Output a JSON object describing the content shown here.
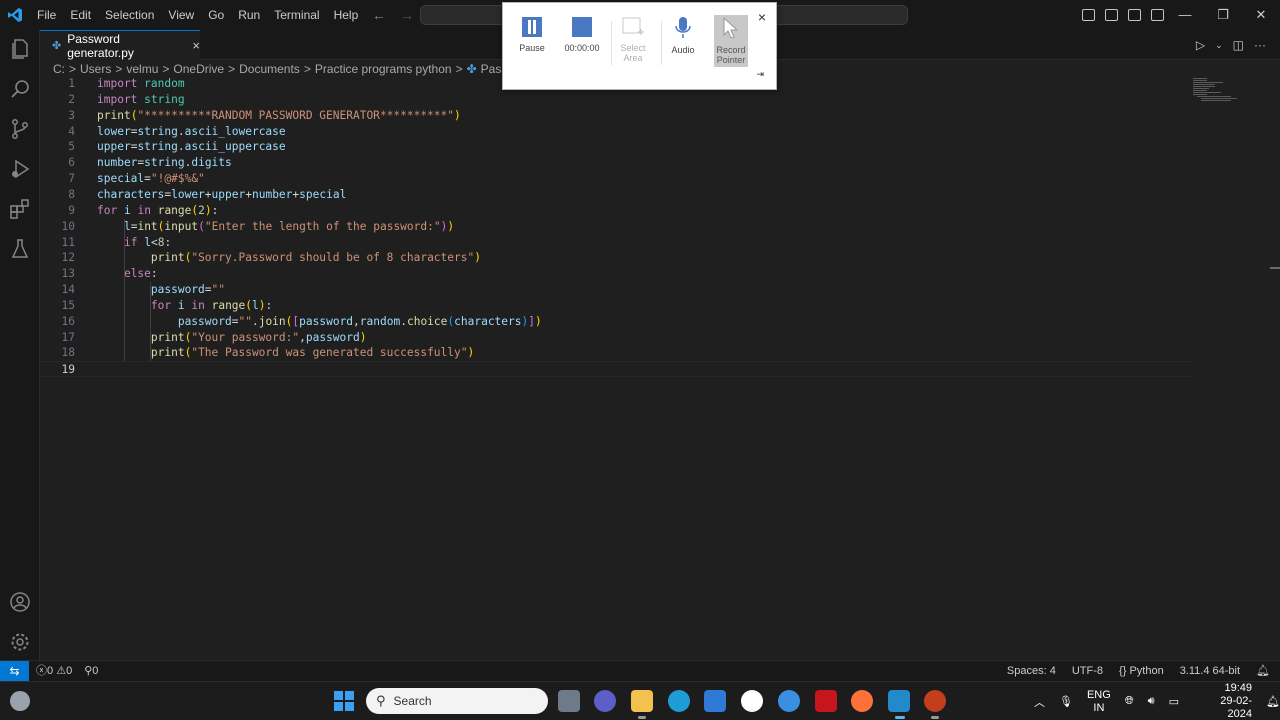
{
  "titlebar": {
    "menu": [
      "File",
      "Edit",
      "Selection",
      "View",
      "Go",
      "Run",
      "Terminal",
      "Help"
    ],
    "window_controls": [
      "minimize-icon",
      "restore-icon",
      "close-icon"
    ]
  },
  "tab": {
    "label": "Password generator.py",
    "close": "×"
  },
  "breadcrumb": [
    "C:",
    "Users",
    "velmu",
    "OneDrive",
    "Documents",
    "Practice programs python",
    "Password ger"
  ],
  "code_lines": [
    "import random",
    "import string",
    "print(\"**********RANDOM PASSWORD GENERATOR**********\")",
    "lower=string.ascii_lowercase",
    "upper=string.ascii_uppercase",
    "number=string.digits",
    "special=\"!@#$%&\"",
    "characters=lower+upper+number+special",
    "for i in range(2):",
    "    l=int(input(\"Enter the length of the password:\"))",
    "    if l<8:",
    "        print(\"Sorry.Password should be of 8 characters\")",
    "    else:",
    "        password=\"\"",
    "        for i in range(l):",
    "            password=\"\".join([password,random.choice(characters)])",
    "        print(\"Your password:\",password)",
    "        print(\"The Password was generated successfully\")",
    ""
  ],
  "recorder": {
    "pause": "Pause",
    "timer": "00:00:00",
    "select_area": "Select Area",
    "audio": "Audio",
    "record_pointer": "Record Pointer",
    "close": "×"
  },
  "statusbar": {
    "errors": "0",
    "warnings": "0",
    "ports": "0",
    "spaces": "Spaces: 4",
    "encoding": "UTF-8",
    "language": "Python",
    "interpreter": "3.11.4 64-bit"
  },
  "taskbar": {
    "search_placeholder": "Search",
    "lang_top": "ENG",
    "lang_bottom": "IN",
    "time": "19:49",
    "date": "29-02-2024"
  },
  "colors": {
    "accent": "#0078d4",
    "editor_bg": "#1f1f1f"
  }
}
